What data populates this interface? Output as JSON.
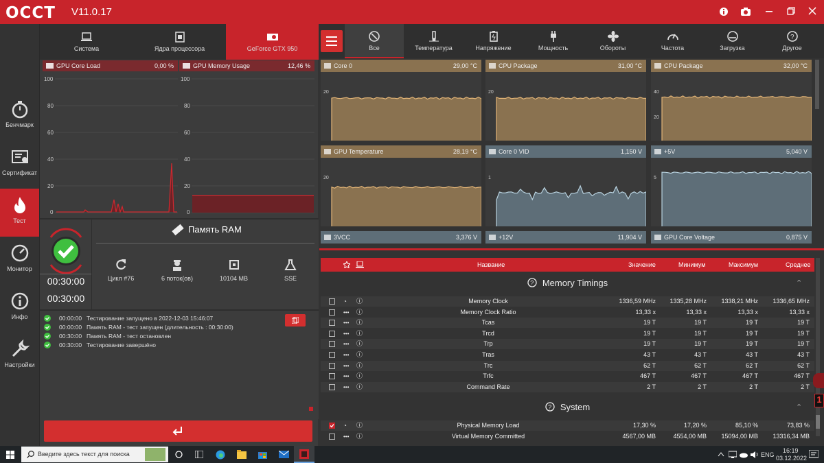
{
  "app": {
    "logo": "OCCT",
    "version": "V11.0.17"
  },
  "sidebar": {
    "items": [
      {
        "label": "Бенчмарк",
        "icon": "stopwatch-icon"
      },
      {
        "label": "Сертификат",
        "icon": "certificate-icon"
      },
      {
        "label": "Тест",
        "icon": "flame-icon",
        "active": true
      },
      {
        "label": "Монитор",
        "icon": "gauge-icon"
      },
      {
        "label": "Инфо",
        "icon": "info-icon"
      },
      {
        "label": "Настройки",
        "icon": "wrench-icon"
      }
    ]
  },
  "left_tabs": [
    {
      "label": "Система",
      "icon": "laptop-icon"
    },
    {
      "label": "Ядра процессора",
      "icon": "cpu-icon"
    },
    {
      "label": "GeForce GTX 950",
      "icon": "gpu-icon",
      "active": true
    }
  ],
  "gpu_charts": [
    {
      "title": "GPU Core Load",
      "value": "0,00 %",
      "ticks": [
        "100",
        "80",
        "60",
        "40",
        "20",
        "0"
      ]
    },
    {
      "title": "GPU Memory Usage",
      "value": "12,46 %",
      "ticks": [
        "100",
        "80",
        "60",
        "40",
        "20",
        "0"
      ]
    }
  ],
  "test": {
    "title": "Память RAM",
    "timer1": "00:30:00",
    "timer2": "00:30:00",
    "stats": [
      {
        "icon": "refresh-icon",
        "label": "Цикл #76"
      },
      {
        "icon": "worker-icon",
        "label": "6 поток(ов)"
      },
      {
        "icon": "chip-icon",
        "label": "10104 MB"
      },
      {
        "icon": "flask-icon",
        "label": "SSE"
      }
    ],
    "log": [
      {
        "time": "00:00:00",
        "text": "Тестирование запущено в 2022-12-03 15:46:07"
      },
      {
        "time": "00:00:00",
        "text": "Память RAM - тест запущен (длительность : 00:30:00)"
      },
      {
        "time": "00:30:00",
        "text": "Память RAM - тест остановлен"
      },
      {
        "time": "00:30:00",
        "text": "Тестирование завершёно"
      }
    ],
    "run_icon": "return-arrow-icon"
  },
  "right_tabs": [
    {
      "label": "Все",
      "icon": "all-icon",
      "active": true
    },
    {
      "label": "Температура",
      "icon": "thermometer-icon"
    },
    {
      "label": "Напряжение",
      "icon": "battery-icon"
    },
    {
      "label": "Мощность",
      "icon": "plug-icon"
    },
    {
      "label": "Обороты",
      "icon": "fan-icon"
    },
    {
      "label": "Частота",
      "icon": "speedometer-icon"
    },
    {
      "label": "Загрузка",
      "icon": "load-gauge-icon"
    },
    {
      "label": "Другое",
      "icon": "question-icon"
    }
  ],
  "mini_charts": [
    {
      "title": "Core 0",
      "value": "29,00 °C",
      "color": "#8a7250",
      "line": "#e3b577",
      "ticks": [
        "20",
        "0"
      ],
      "level": 0.78
    },
    {
      "title": "CPU Package",
      "value": "31,00 °C",
      "color": "#8a7250",
      "line": "#e3b577",
      "ticks": [
        "20",
        "0"
      ],
      "level": 0.78
    },
    {
      "title": "CPU Package",
      "value": "32,00 °C",
      "color": "#8a7250",
      "line": "#e3b577",
      "ticks": [
        "40",
        "20",
        "0"
      ],
      "level": 0.8
    },
    {
      "title": "GPU Temperature",
      "value": "28,19 °C",
      "color": "#8a7250",
      "line": "#e3b577",
      "ticks": [
        "20",
        "0"
      ],
      "level": 0.72
    },
    {
      "title": "Core 0 VID",
      "value": "1,150 V",
      "color": "#5e6e78",
      "line": "#b9d3e0",
      "ticks": [
        "1",
        "0"
      ],
      "level": 0.62
    },
    {
      "title": "+5V",
      "value": "5,040 V",
      "color": "#5e6e78",
      "line": "#b9d3e0",
      "ticks": [
        "5",
        "0"
      ],
      "level": 0.98
    }
  ],
  "mini_bottom": [
    {
      "title": "3VCC",
      "value": "3,376 V"
    },
    {
      "title": "+12V",
      "value": "11,904 V"
    },
    {
      "title": "GPU Core Voltage",
      "value": "0,875 V"
    }
  ],
  "table": {
    "headers": {
      "name": "Название",
      "value": "Значение",
      "min": "Минимум",
      "max": "Максимум",
      "avg": "Среднее"
    },
    "sections": [
      {
        "title": "Memory Timings",
        "rows": [
          {
            "name": "Memory Clock",
            "value": "1336,59 MHz",
            "min": "1335,28 MHz",
            "max": "1338,21 MHz",
            "avg": "1336,65 MHz"
          },
          {
            "name": "Memory Clock Ratio",
            "value": "13,33 x",
            "min": "13,33 x",
            "max": "13,33 x",
            "avg": "13,33 x"
          },
          {
            "name": "Tcas",
            "value": "19 T",
            "min": "19 T",
            "max": "19 T",
            "avg": "19 T"
          },
          {
            "name": "Trcd",
            "value": "19 T",
            "min": "19 T",
            "max": "19 T",
            "avg": "19 T"
          },
          {
            "name": "Trp",
            "value": "19 T",
            "min": "19 T",
            "max": "19 T",
            "avg": "19 T"
          },
          {
            "name": "Tras",
            "value": "43 T",
            "min": "43 T",
            "max": "43 T",
            "avg": "43 T"
          },
          {
            "name": "Trc",
            "value": "62 T",
            "min": "62 T",
            "max": "62 T",
            "avg": "62 T"
          },
          {
            "name": "Trfc",
            "value": "467 T",
            "min": "467 T",
            "max": "467 T",
            "avg": "467 T"
          },
          {
            "name": "Command Rate",
            "value": "2 T",
            "min": "2 T",
            "max": "2 T",
            "avg": "2 T"
          }
        ]
      },
      {
        "title": "System",
        "rows": [
          {
            "name": "Physical Memory Load",
            "value": "17,30 %",
            "min": "17,20 %",
            "max": "85,10 %",
            "avg": "73,83 %",
            "checked": true
          },
          {
            "name": "Virtual Memory Committed",
            "value": "4567,00 MB",
            "min": "4554,00 MB",
            "max": "15094,00 MB",
            "avg": "13316,34 MB"
          }
        ]
      }
    ]
  },
  "taskbar": {
    "search": "Введите здесь текст для поиска",
    "lang": "ENG",
    "time": "16:19",
    "date": "03.12.2022"
  },
  "colors": {
    "accent": "#c8242b",
    "ok": "#3fbf3f"
  }
}
